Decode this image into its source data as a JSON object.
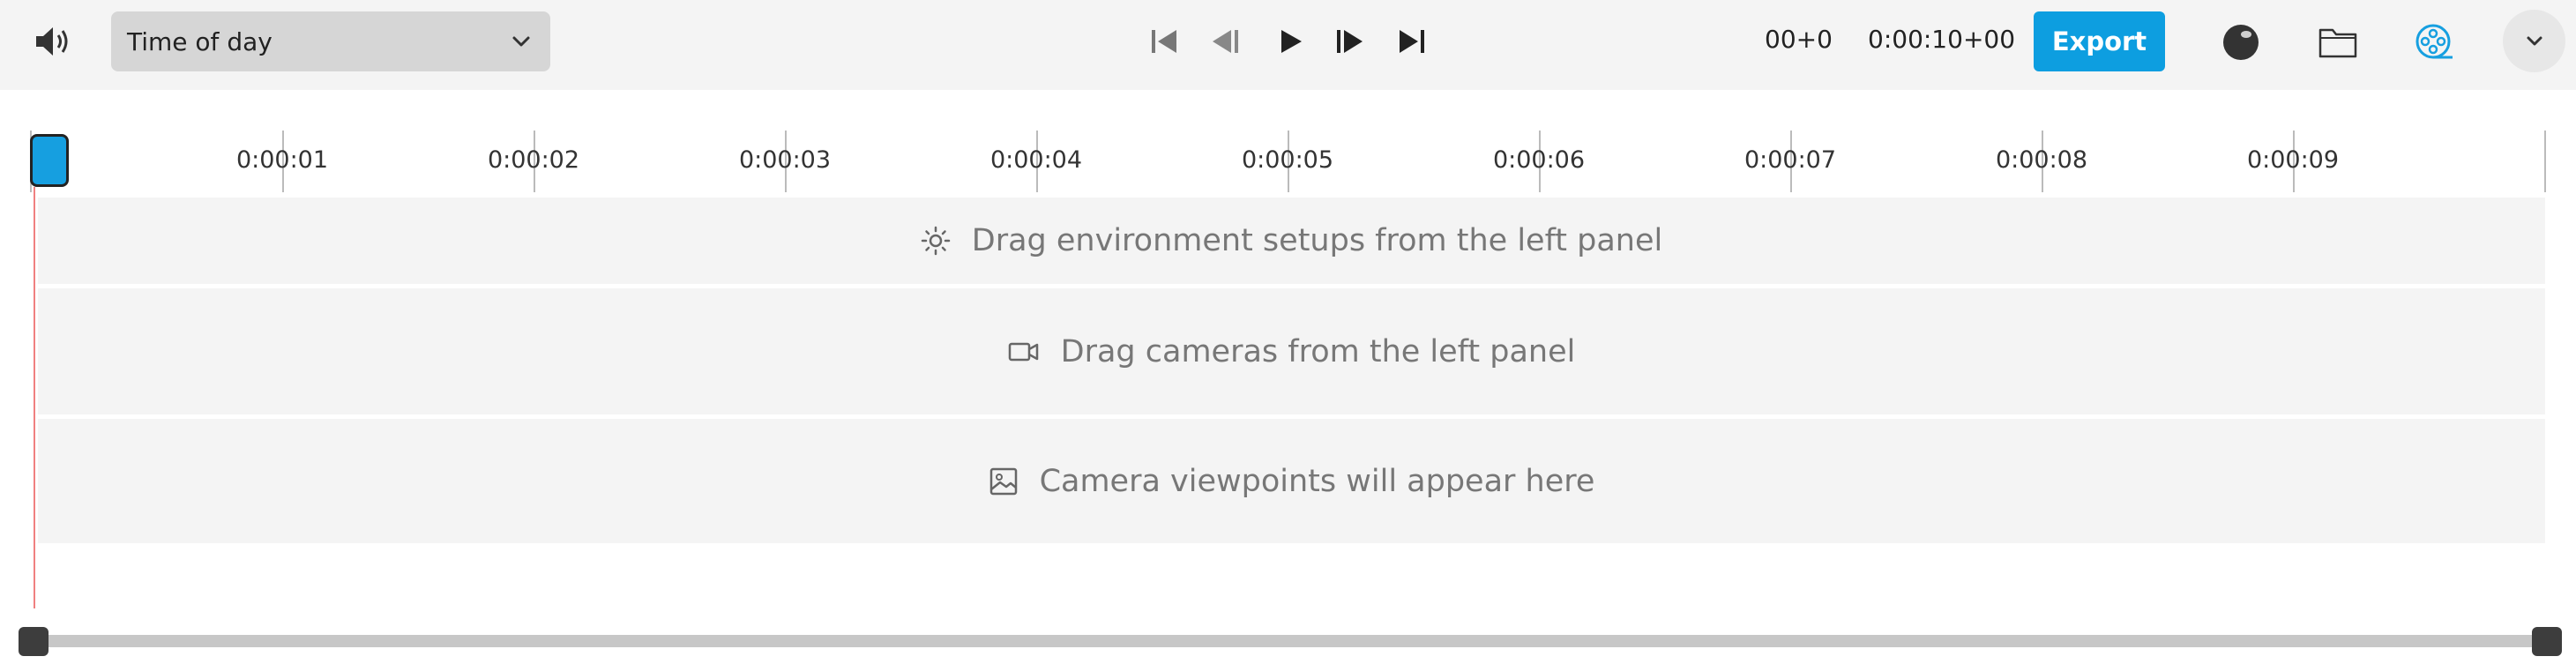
{
  "toolbar": {
    "icons": {
      "volume": "speaker-icon",
      "chevron": "chevron-down-icon",
      "skip_start": "skip-to-start-icon",
      "step_back": "step-back-icon",
      "play": "play-icon",
      "step_forward": "step-forward-icon",
      "skip_end": "skip-to-end-icon",
      "render": "sphere-icon",
      "folder": "folder-icon",
      "film": "film-reel-icon",
      "more": "chevron-down-icon"
    },
    "mode_select": {
      "value": "Time of day"
    },
    "current_time": "00+0",
    "duration": "0:00:10+00",
    "export_label": "Export",
    "accent_color": "#0d9ee0"
  },
  "timeline": {
    "ticks": [
      "0:00:01",
      "0:00:02",
      "0:00:03",
      "0:00:04",
      "0:00:05",
      "0:00:06",
      "0:00:07",
      "0:00:08",
      "0:00:09"
    ],
    "playhead_color": "#169fe0"
  },
  "tracks": {
    "environment": {
      "icon": "sun-icon",
      "text": "Drag environment setups from the left panel"
    },
    "cameras": {
      "icon": "video-camera-icon",
      "text": "Drag cameras from the left panel"
    },
    "viewpoints": {
      "icon": "image-icon",
      "text": "Camera viewpoints will appear here"
    }
  }
}
